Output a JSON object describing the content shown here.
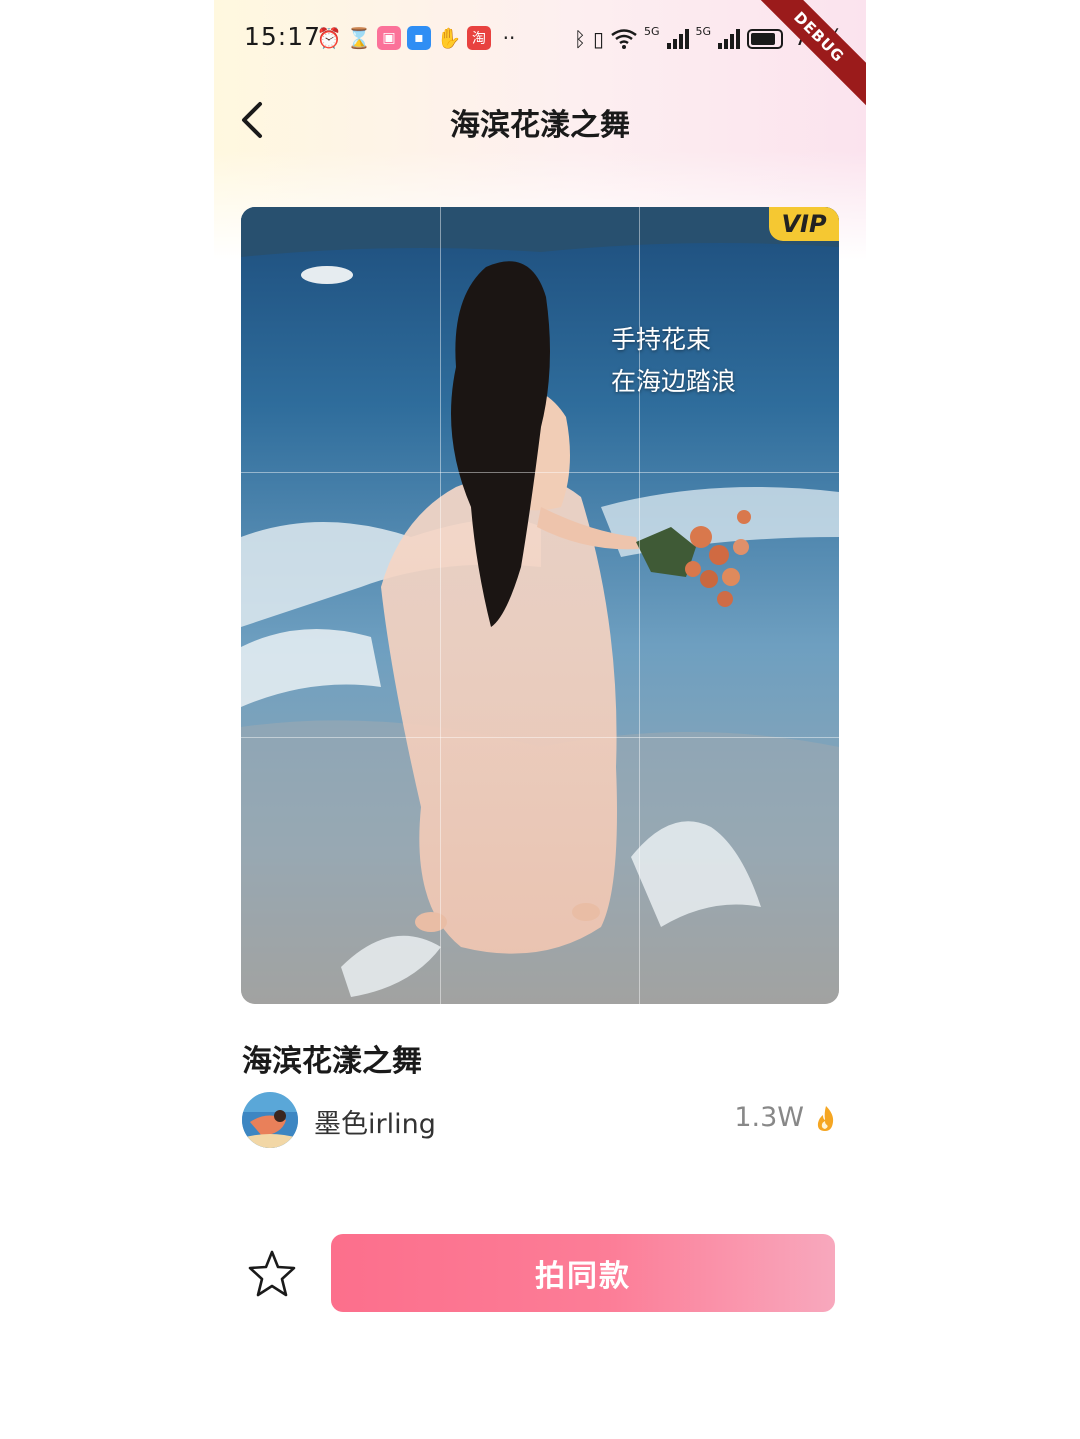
{
  "status_bar": {
    "time": "15:17",
    "battery": "77%",
    "network_badges": [
      "5G",
      "5G"
    ],
    "left_icons": [
      "alarm-icon",
      "hourglass-icon",
      "bilibili-icon",
      "message-app-icon",
      "hand-app-icon",
      "taobao-icon"
    ],
    "right_icons": [
      "bluetooth-icon",
      "vibrate-icon",
      "wifi-icon",
      "signal-icon",
      "signal-icon",
      "battery-icon"
    ],
    "debug_label": "DEBUG"
  },
  "header": {
    "title": "海滨花漾之舞",
    "back_icon": "chevron-left-icon"
  },
  "photo": {
    "vip_label": "VIP",
    "caption_lines": [
      "手持花束",
      "在海边踏浪"
    ]
  },
  "work": {
    "title": "海滨花漾之舞",
    "author": "墨色irling",
    "hot_count": "1.3W",
    "hot_icon": "fire-icon"
  },
  "actions": {
    "favorite_icon": "star-icon",
    "shoot_label": "拍同款"
  },
  "colors": {
    "accent": "#fc6f8c",
    "vip": "#f5c832",
    "fire": "#f5a623"
  }
}
